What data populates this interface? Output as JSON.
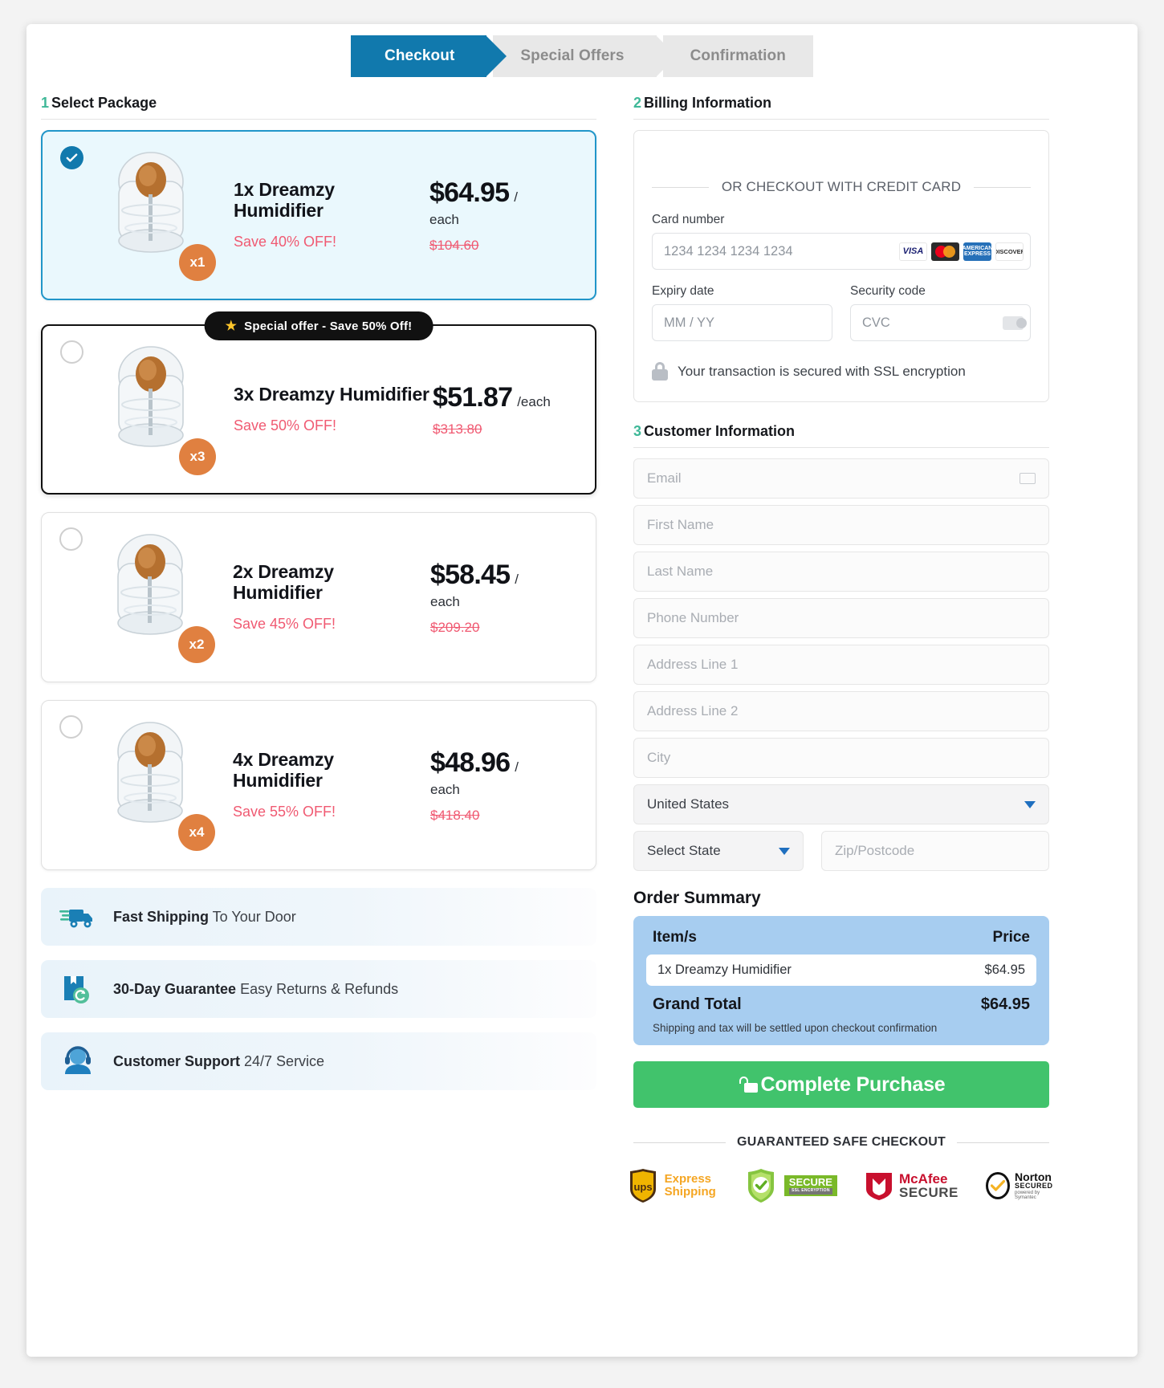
{
  "steps": [
    {
      "label": "Checkout",
      "active": true
    },
    {
      "label": "Special Offers",
      "active": false
    },
    {
      "label": "Confirmation",
      "active": false
    }
  ],
  "left": {
    "section_number": "1",
    "section_title": "Select Package",
    "packages": [
      {
        "qty_badge": "x1",
        "title": "1x Dreamzy Humidifier",
        "save": "Save 40% OFF!",
        "price": "$64.95",
        "price_unit": "/",
        "price_each": "each",
        "price_old": "$104.60",
        "selected": true,
        "ribbon": ""
      },
      {
        "qty_badge": "x3",
        "title": "3x Dreamzy Humidifier",
        "save": "Save 50% OFF!",
        "price": "$51.87",
        "price_unit": "/each",
        "price_each": "",
        "price_old": "$313.80",
        "selected": false,
        "ribbon": "Special offer - Save 50% Off!"
      },
      {
        "qty_badge": "x2",
        "title": "2x Dreamzy Humidifier",
        "save": "Save 45% OFF!",
        "price": "$58.45",
        "price_unit": "/",
        "price_each": "each",
        "price_old": "$209.20",
        "selected": false,
        "ribbon": ""
      },
      {
        "qty_badge": "x4",
        "title": "4x Dreamzy Humidifier",
        "save": "Save 55% OFF!",
        "price": "$48.96",
        "price_unit": "/",
        "price_each": "each",
        "price_old": "$418.40",
        "selected": false,
        "ribbon": ""
      }
    ],
    "benefits": [
      {
        "icon": "truck-icon",
        "bold": "Fast Shipping",
        "rest": " To Your Door"
      },
      {
        "icon": "return-box-icon",
        "bold": "30-Day Guarantee",
        "rest": " Easy Returns & Refunds"
      },
      {
        "icon": "headset-agent-icon",
        "bold": "Customer Support",
        "rest": " 24/7 Service"
      }
    ]
  },
  "billing": {
    "section_number": "2",
    "section_title": "Billing Information",
    "or_divider": "OR CHECKOUT WITH CREDIT CARD",
    "card_number_label": "Card number",
    "card_number_placeholder": "1234 1234 1234 1234",
    "card_brands": [
      "VISA",
      "mastercard",
      "AMEX",
      "DISCOVER"
    ],
    "expiry_label": "Expiry date",
    "expiry_placeholder": "MM / YY",
    "cvc_label": "Security code",
    "cvc_placeholder": "CVC",
    "ssl_text": "Your transaction is secured with SSL encryption"
  },
  "customer": {
    "section_number": "3",
    "section_title": "Customer Information",
    "fields": [
      {
        "placeholder": "Email",
        "icon": "mail-icon"
      },
      {
        "placeholder": "First Name",
        "icon": ""
      },
      {
        "placeholder": "Last Name",
        "icon": ""
      },
      {
        "placeholder": "Phone Number",
        "icon": ""
      },
      {
        "placeholder": "Address Line 1",
        "icon": ""
      },
      {
        "placeholder": "Address Line 2",
        "icon": ""
      },
      {
        "placeholder": "City",
        "icon": ""
      }
    ],
    "country_value": "United States",
    "state_value": "Select State",
    "zip_placeholder": "Zip/Postcode"
  },
  "order_summary": {
    "title": "Order Summary",
    "col_items": "Item/s",
    "col_price": "Price",
    "items": [
      {
        "name": "1x Dreamzy Humidifier",
        "price": "$64.95"
      }
    ],
    "grand_total_label": "Grand Total",
    "grand_total_value": "$64.95",
    "note": "Shipping and tax will be settled upon checkout confirmation",
    "buy_button": "Complete Purchase"
  },
  "footer": {
    "guarantee_text": "GUARANTEED SAFE CHECKOUT",
    "badges": [
      {
        "name": "ups-express-shipping-badge",
        "line1": "Express",
        "line2": "Shipping",
        "mark": "ups"
      },
      {
        "name": "ssl-secure-badge",
        "line1": "SECURE",
        "line2": "SSL ENCRYPTION",
        "mark": "secure"
      },
      {
        "name": "mcafee-secure-badge",
        "line1": "McAfee",
        "line2": "SECURE",
        "mark": "mcafee"
      },
      {
        "name": "norton-secured-badge",
        "line1": "Norton",
        "line2": "SECURED",
        "line3": "powered by Symantec",
        "mark": "norton"
      }
    ]
  },
  "colors": {
    "accent_blue": "#1179ad",
    "selected_bg": "#eaf8fd",
    "save_red": "#f05a72",
    "qty_orange": "#e08040",
    "summary_blue": "#a7cdf0",
    "buy_green": "#41c36c",
    "step_number_green": "#3fb898"
  }
}
